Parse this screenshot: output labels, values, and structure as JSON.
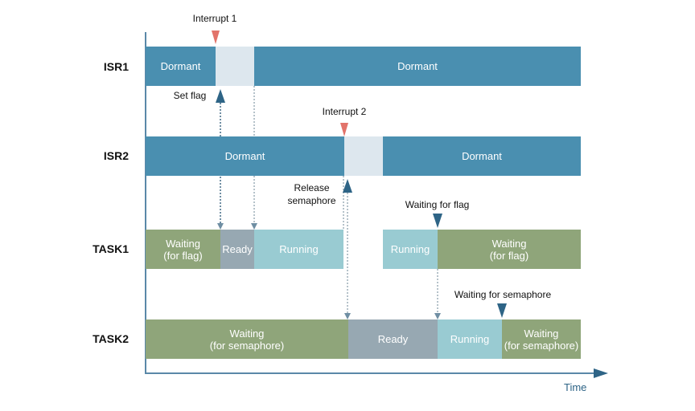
{
  "colors": {
    "isr_dormant": "#4a8fb0",
    "isr_active": "#dde7ee",
    "waiting": "#8fa57a",
    "ready": "#97a8b2",
    "running": "#99cbd2",
    "interrupt_marker": "#e2736a",
    "event_marker": "#2e6486",
    "axis": "#5a88a8",
    "dotted_dark": "#6f8ea3",
    "dotted_light": "#b5c2ca"
  },
  "rows": [
    {
      "id": "isr1",
      "label": "ISR1",
      "segments": [
        {
          "state": "dormant",
          "label": "Dormant",
          "start": 0,
          "end": 87
        },
        {
          "state": "active",
          "label": "",
          "start": 87,
          "end": 135
        },
        {
          "state": "dormant",
          "label": "Dormant",
          "start": 135,
          "end": 541
        }
      ]
    },
    {
      "id": "isr2",
      "label": "ISR2",
      "segments": [
        {
          "state": "dormant",
          "label": "Dormant",
          "start": 0,
          "end": 247
        },
        {
          "state": "active",
          "label": "",
          "start": 247,
          "end": 295
        },
        {
          "state": "dormant",
          "label": "Dormant",
          "start": 295,
          "end": 541
        }
      ]
    },
    {
      "id": "task1",
      "label": "TASK1",
      "segments": [
        {
          "state": "waiting",
          "label": "Waiting\n(for flag)",
          "start": 0,
          "end": 93
        },
        {
          "state": "ready",
          "label": "Ready",
          "start": 93,
          "end": 135
        },
        {
          "state": "running",
          "label": "Running",
          "start": 135,
          "end": 246
        },
        {
          "state": "running",
          "label": "Running",
          "start": 295,
          "end": 363
        },
        {
          "state": "waiting",
          "label": "Waiting\n(for flag)",
          "start": 363,
          "end": 541
        }
      ]
    },
    {
      "id": "task2",
      "label": "TASK2",
      "segments": [
        {
          "state": "waiting",
          "label": "Waiting\n(for semaphore)",
          "start": 0,
          "end": 252
        },
        {
          "state": "ready",
          "label": "Ready",
          "start": 252,
          "end": 363
        },
        {
          "state": "running",
          "label": "Running",
          "start": 363,
          "end": 443
        },
        {
          "state": "waiting",
          "label": "Waiting\n(for semaphore)",
          "start": 443,
          "end": 541
        }
      ]
    }
  ],
  "annotations": {
    "interrupt1": "Interrupt 1",
    "interrupt2": "Interrupt 2",
    "set_flag": "Set flag",
    "release_semaphore": "Release\nsemaphore",
    "waiting_for_flag": "Waiting for flag",
    "waiting_for_semaphore": "Waiting for semaphore"
  },
  "axis": {
    "x_label": "Time",
    "time_max": 541
  }
}
